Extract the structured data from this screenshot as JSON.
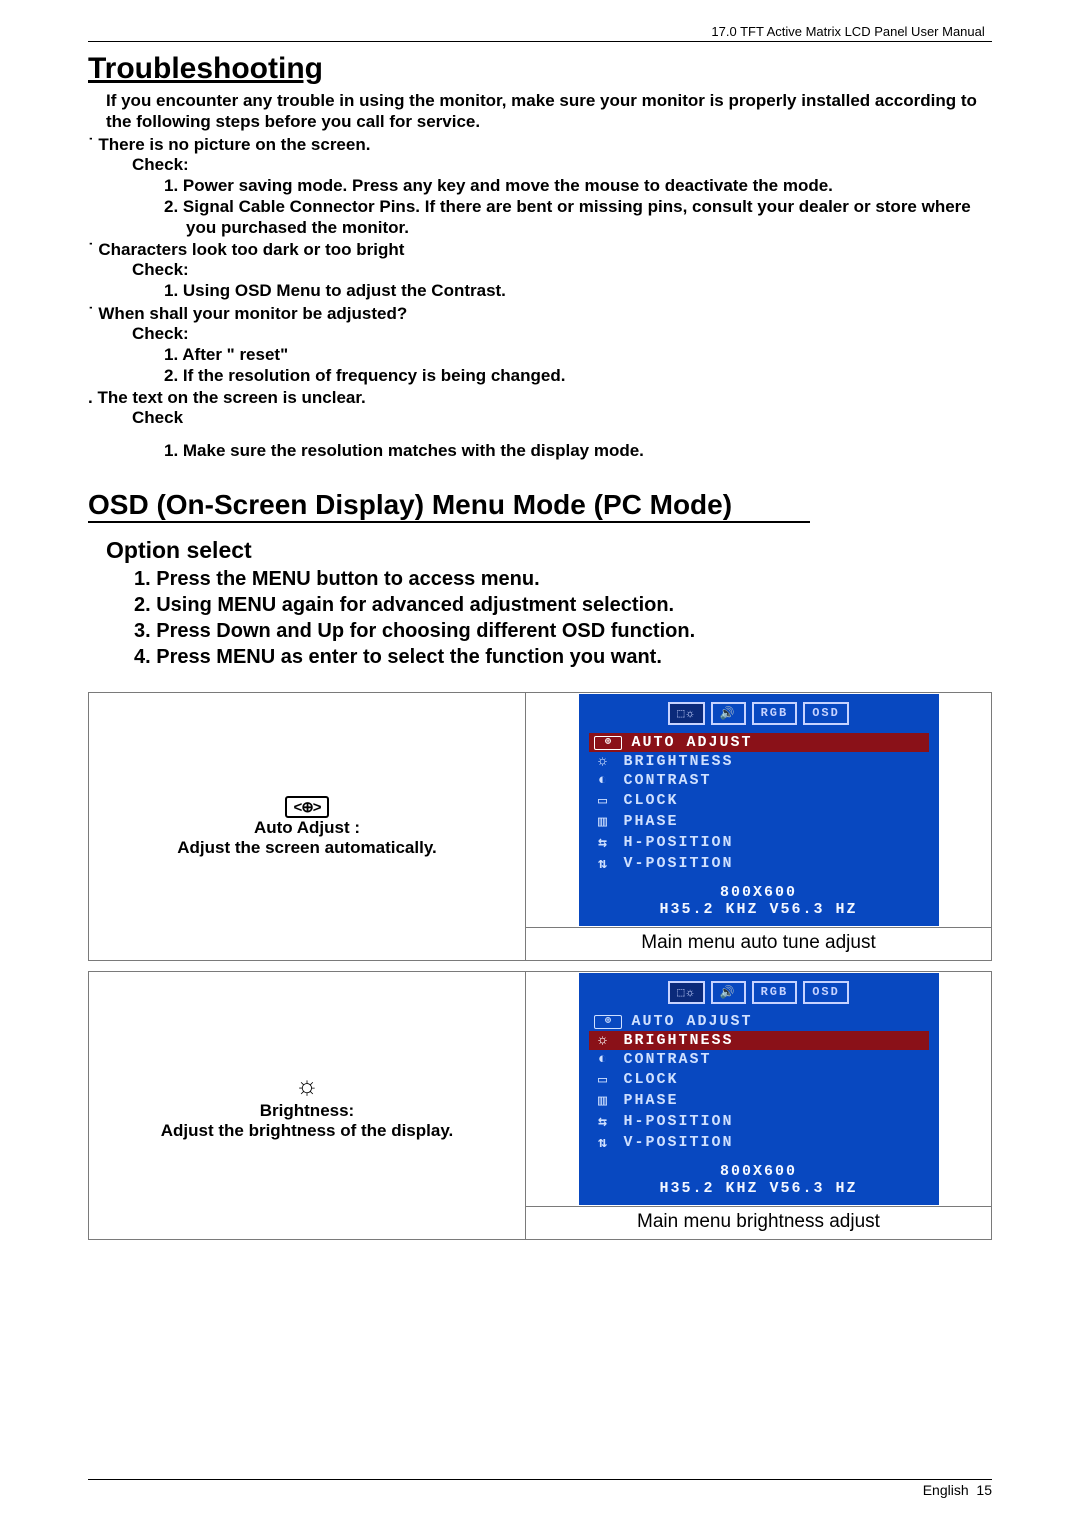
{
  "header_doc_title": "17.0 TFT Active Matrix LCD Panel User Manual",
  "troubleshooting": {
    "title": "Troubleshooting",
    "lead": "If you encounter any trouble in using the monitor, make sure your monitor is properly installed according to the following steps before you call for service.",
    "s1": {
      "title": "˙ There is no picture on the screen.",
      "check": "Check:",
      "i1": "1.  Power saving mode. Press any key and move the mouse to deactivate the mode.",
      "i2": "2.  Signal Cable Connector Pins. If there are bent or missing pins, consult your dealer or store where you purchased the monitor."
    },
    "s2": {
      "title": "˙ Characters look too dark or too bright",
      "check": "Check:",
      "i1": "1.  Using OSD Menu to adjust the Contrast."
    },
    "s3": {
      "title": "˙ When shall your monitor be adjusted?",
      "check": "Check:",
      "i1": "1.  After \" reset\"",
      "i2": "2.  If the resolution of frequency is being changed."
    },
    "s4": {
      "title": ". The text on the screen is unclear.",
      "check": "Check",
      "i1": "1.  Make sure the resolution matches with the display mode."
    }
  },
  "osd": {
    "title": "OSD (On-Screen Display) Menu Mode (PC Mode)",
    "option_title": "Option select",
    "o1": "1.  Press the MENU button to access menu.",
    "o2": "2.  Using MENU again for advanced adjustment selection.",
    "o3": "3.  Press Down and Up for choosing different OSD function.",
    "o4": "4.  Press MENU as enter to select the function you want."
  },
  "panel1": {
    "label": "Auto Adjust :",
    "desc": "Adjust the screen automatically.",
    "caption": "Main menu auto tune adjust"
  },
  "panel2": {
    "label": "Brightness:",
    "desc": "Adjust the brightness of the display",
    "caption": "Main menu brightness adjust"
  },
  "osd_menu": {
    "tabs": [
      "⬚☼",
      "🔊",
      "RGB",
      "OSD"
    ],
    "items": [
      "AUTO ADJUST",
      "BRIGHTNESS",
      "CONTRAST",
      "CLOCK",
      "PHASE",
      "H-POSITION",
      "V-POSITION"
    ],
    "resolution": "800X600",
    "freq": "H35.2 KHZ V56.3 HZ"
  },
  "footer": {
    "lang": "English",
    "page": "15"
  }
}
